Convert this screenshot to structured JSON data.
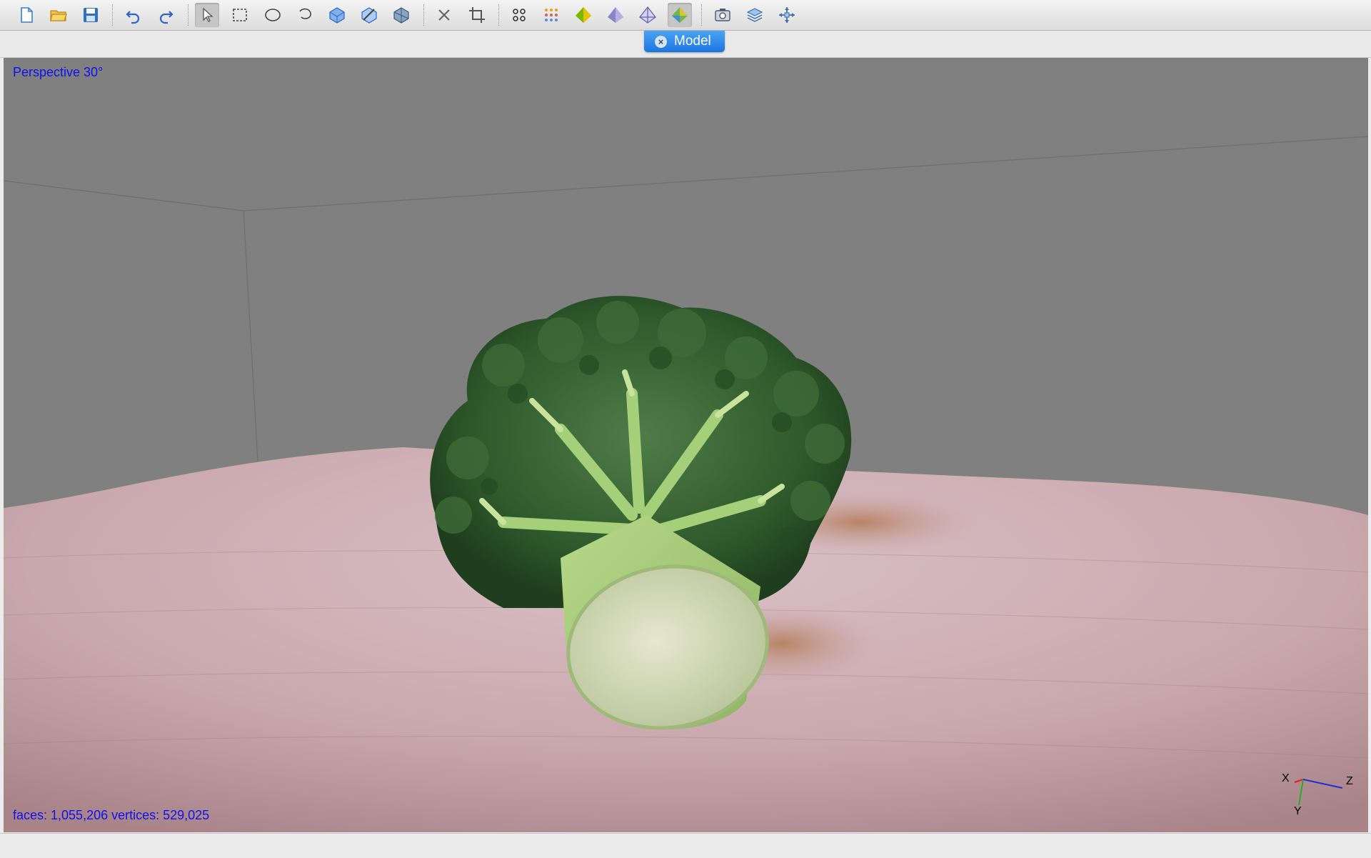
{
  "toolbar": {
    "buttons": [
      {
        "icon": "new-file-icon"
      },
      {
        "icon": "open-folder-icon"
      },
      {
        "icon": "save-icon"
      },
      {
        "icon": "undo-icon"
      },
      {
        "icon": "redo-icon"
      },
      {
        "icon": "select-arrow-icon",
        "active": true
      },
      {
        "icon": "rect-select-icon"
      },
      {
        "icon": "ellipse-select-icon"
      },
      {
        "icon": "lasso-select-icon"
      },
      {
        "icon": "select-faces-icon"
      },
      {
        "icon": "select-brush-icon"
      },
      {
        "icon": "select-connected-icon"
      },
      {
        "icon": "delete-icon"
      },
      {
        "icon": "crop-icon"
      },
      {
        "icon": "points-icon"
      },
      {
        "icon": "grid-points-icon"
      },
      {
        "icon": "solid-shading-icon"
      },
      {
        "icon": "flat-shading-icon"
      },
      {
        "icon": "wireframe-icon"
      },
      {
        "icon": "texture-shading-icon",
        "active": true
      },
      {
        "icon": "screenshot-icon"
      },
      {
        "icon": "layers-icon"
      },
      {
        "icon": "move-icon"
      }
    ]
  },
  "tab": {
    "label": "Model",
    "close_label": "×"
  },
  "viewport": {
    "projection_label": "Perspective 30°",
    "stats": "faces: 1,055,206 vertices: 529,025",
    "background_color": "#808080"
  },
  "axis_gizmo": {
    "x_label": "X",
    "y_label": "Y",
    "z_label": "Z"
  },
  "colors": {
    "accent": "#1d76e0",
    "overlay_text": "#1010ee"
  }
}
